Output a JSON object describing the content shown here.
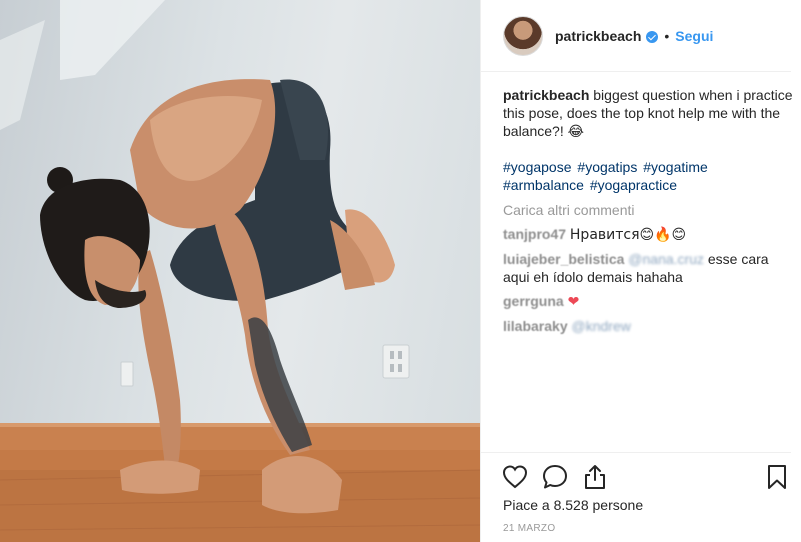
{
  "post": {
    "username": "patrickbeach",
    "follow_label": "Segui",
    "separator": "•",
    "caption": {
      "username": "patrickbeach",
      "text": "biggest question when i practice this pose, does the top knot help me with the balance?! 😂"
    },
    "hashtags": [
      "#yogapose",
      "#yogatips",
      "#yogatime",
      "#armbalance",
      "#yogapractice"
    ],
    "load_more_label": "Carica altri commenti",
    "comments": [
      {
        "username": "tanjpro47",
        "text": "Нравится😊🔥😊"
      },
      {
        "username": "luiajeber_belistica",
        "mention": "@nana.cruz",
        "text": " esse cara aqui eh ídolo demais hahaha"
      },
      {
        "username": "gerrguna",
        "text": "❤"
      },
      {
        "username": "lilabaraky",
        "mention": "@kndrew",
        "text": ""
      }
    ],
    "likes_text": "Piace a 8.528 persone",
    "date": "21 MARZO"
  },
  "icons": {
    "verified": "verified-badge-icon",
    "like": "heart-outline-icon",
    "comment": "comment-bubble-icon",
    "share": "share-upload-icon",
    "save": "bookmark-icon"
  },
  "colors": {
    "link_blue": "#3897f0",
    "hashtag": "#003569",
    "muted": "#999999",
    "heart_red": "#ed4956"
  }
}
